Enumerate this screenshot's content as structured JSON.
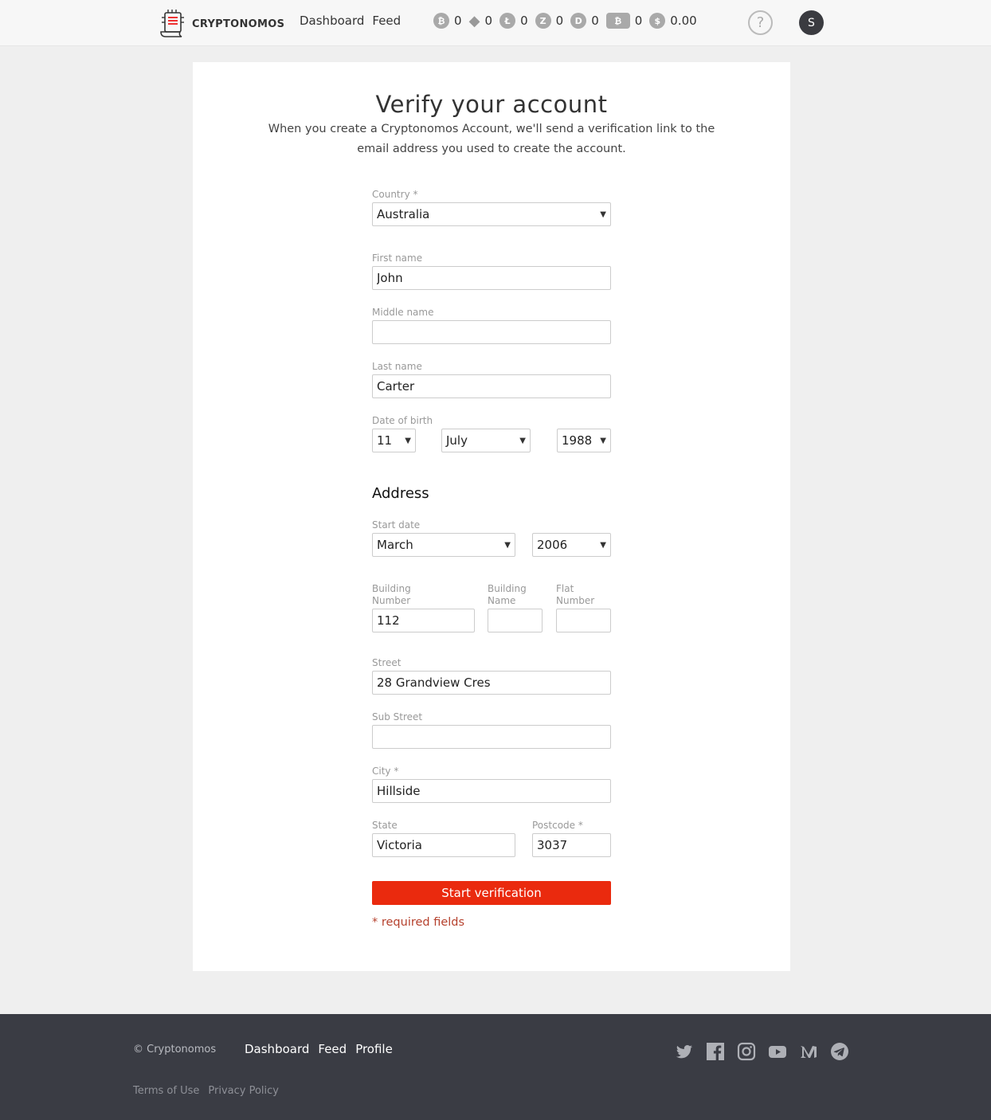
{
  "header": {
    "logo_text": "CRYPTONOMOS",
    "nav": [
      "Dashboard",
      "Feed"
    ],
    "balances": [
      {
        "icon": "bitcoin-icon",
        "symbol": "₿",
        "value": "0"
      },
      {
        "icon": "ethereum-icon",
        "symbol": "◆",
        "value": "0"
      },
      {
        "icon": "litecoin-icon",
        "symbol": "Ł",
        "value": "0"
      },
      {
        "icon": "zcash-icon",
        "symbol": "Z",
        "value": "0"
      },
      {
        "icon": "dash-icon",
        "symbol": "D",
        "value": "0"
      },
      {
        "icon": "bitcoin-cash-icon",
        "symbol": "₿",
        "value": "0"
      },
      {
        "icon": "dollar-icon",
        "symbol": "$",
        "value": "0.00"
      }
    ],
    "help": "?",
    "avatar_initial": "S"
  },
  "form": {
    "title": "Verify your account",
    "subtitle": "When you create a Cryptonomos Account, we'll send a verification link to the email address you used to create the account.",
    "country": {
      "label": "Country *",
      "value": "Australia"
    },
    "first_name": {
      "label": "First name",
      "value": "John"
    },
    "middle_name": {
      "label": "Middle name",
      "value": ""
    },
    "last_name": {
      "label": "Last name",
      "value": "Carter"
    },
    "dob": {
      "label": "Date of birth",
      "day": "11",
      "month": "July",
      "year": "1988"
    },
    "address_heading": "Address",
    "start_date": {
      "label": "Start date",
      "month": "March",
      "year": "2006"
    },
    "building_number": {
      "label_1": "Building",
      "label_2": "Number",
      "value": "112"
    },
    "building_name": {
      "label_1": "Building",
      "label_2": "Name",
      "value": ""
    },
    "flat_number": {
      "label_1": "Flat",
      "label_2": "Number",
      "value": ""
    },
    "street": {
      "label": "Street",
      "value": "28 Grandview Cres"
    },
    "sub_street": {
      "label": "Sub Street",
      "value": ""
    },
    "city": {
      "label": "City *",
      "value": "Hillside"
    },
    "state": {
      "label": "State",
      "value": "Victoria"
    },
    "postcode": {
      "label": "Postcode *",
      "value": "3037"
    },
    "submit_label": "Start verification",
    "required_note": "* required fields"
  },
  "footer": {
    "copyright": "© Cryptonomos",
    "nav": [
      "Dashboard",
      "Feed",
      "Profile"
    ],
    "links": [
      "Terms of Use",
      "Privacy Policy"
    ],
    "social": [
      "twitter-icon",
      "facebook-icon",
      "instagram-icon",
      "youtube-icon",
      "medium-icon",
      "telegram-icon"
    ]
  },
  "colors": {
    "accent": "#ea2a0e",
    "footer_bg": "#3a3c44",
    "required": "#b5402c"
  }
}
